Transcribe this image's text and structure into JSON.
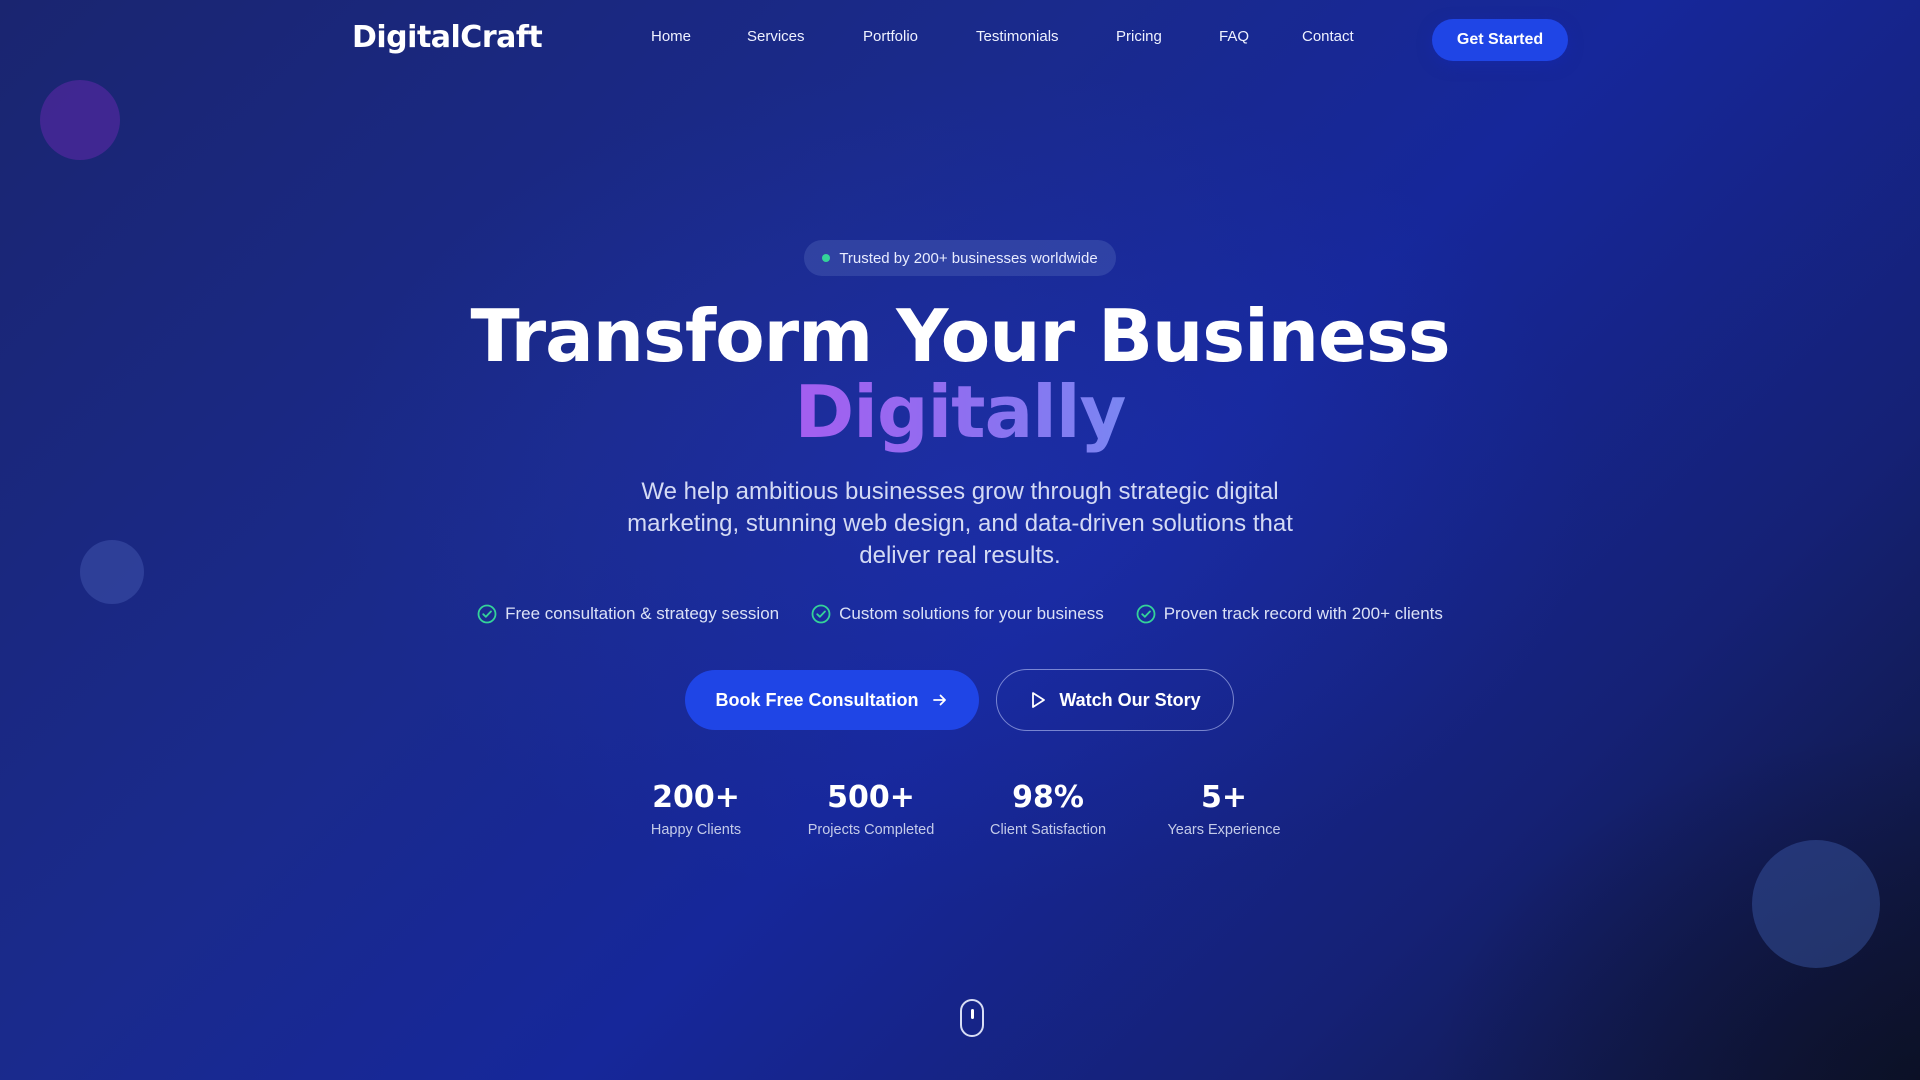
{
  "nav": {
    "logo": "DigitalCraft",
    "links": [
      "Home",
      "Services",
      "Portfolio",
      "Testimonials",
      "Pricing",
      "FAQ",
      "Contact"
    ],
    "cta": "Get Started"
  },
  "hero": {
    "badge": "Trusted by 200+ businesses worldwide",
    "headline_line1": "Transform Your Business",
    "headline_line2": "Digitally",
    "subtitle": "We help ambitious businesses grow through strategic digital marketing, stunning web design, and data-driven solutions that deliver real results.",
    "features": [
      "Free consultation & strategy session",
      "Custom solutions for your business",
      "Proven track record with 200+ clients"
    ],
    "primary_cta": "Book Free Consultation",
    "secondary_cta": "Watch Our Story"
  },
  "stats": [
    {
      "value": "200+",
      "label": "Happy Clients"
    },
    {
      "value": "500+",
      "label": "Projects Completed"
    },
    {
      "value": "98%",
      "label": "Client Satisfaction"
    },
    {
      "value": "5+",
      "label": "Years Experience"
    }
  ],
  "icons": {
    "feature": "check-circle-icon",
    "primary_cta": "arrow-right-icon",
    "secondary_cta": "play-icon",
    "scroll": "mouse-scroll-icon"
  },
  "colors": {
    "accent": "#1f45e6",
    "check": "#34d399",
    "gradient_start": "#a45ef0",
    "gradient_end": "#7a86f2"
  }
}
